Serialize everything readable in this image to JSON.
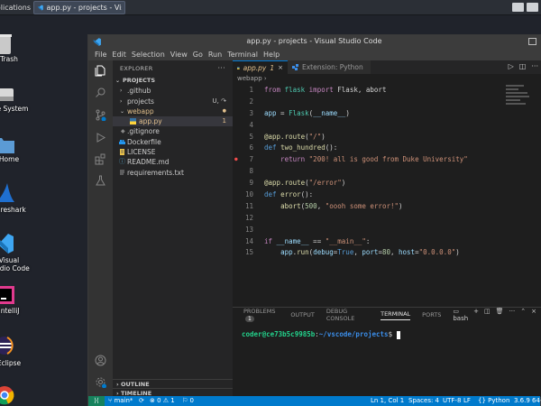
{
  "topbar": {
    "applications_label": "Applications",
    "task_title": "app.py - projects - Visu..."
  },
  "desktop": {
    "icons": [
      {
        "name": "trash",
        "label": "Trash"
      },
      {
        "name": "file-system",
        "label": "File System"
      },
      {
        "name": "home",
        "label": "Home"
      },
      {
        "name": "wireshark",
        "label": "Wireshark"
      },
      {
        "name": "vscode",
        "label": "Visual Studio Code"
      },
      {
        "name": "intellij",
        "label": "IntelliJ"
      },
      {
        "name": "eclipse",
        "label": "Eclipse"
      },
      {
        "name": "chrome",
        "label": ""
      }
    ]
  },
  "window": {
    "title": "app.py - projects - Visual Studio Code"
  },
  "menu": [
    "File",
    "Edit",
    "Selection",
    "View",
    "Go",
    "Run",
    "Terminal",
    "Help"
  ],
  "explorer": {
    "header": "EXPLORER",
    "more": "···",
    "root": "PROJECTS",
    "items": [
      {
        "chev": "›",
        "name": ".github",
        "badge": "",
        "type": "folder"
      },
      {
        "chev": "›",
        "name": "projects",
        "badge": "U, ↷",
        "type": "folder"
      },
      {
        "chev": "⌄",
        "name": "webapp",
        "badge": "●",
        "type": "folder"
      },
      {
        "chev": "",
        "name": "app.py",
        "badge": "1",
        "type": "py"
      },
      {
        "chev": "",
        "name": ".gitignore",
        "badge": "",
        "type": "file"
      },
      {
        "chev": "",
        "name": "Dockerfile",
        "badge": "",
        "type": "docker"
      },
      {
        "chev": "",
        "name": "LICENSE",
        "badge": "",
        "type": "license"
      },
      {
        "chev": "",
        "name": "README.md",
        "badge": "",
        "type": "md"
      },
      {
        "chev": "",
        "name": "requirements.txt",
        "badge": "",
        "type": "txt"
      }
    ],
    "outline": "OUTLINE",
    "timeline": "TIMELINE"
  },
  "tabs": [
    {
      "label": "app.py",
      "suffix": "1",
      "close": "×",
      "active": true
    },
    {
      "label": "Extension: Python",
      "active": false
    }
  ],
  "breadcrumb": "webapp",
  "code": [
    {
      "n": "1",
      "parts": [
        [
          "kw",
          "from "
        ],
        [
          "mod",
          "flask"
        ],
        [
          "kw",
          " import "
        ],
        [
          "",
          "Flask, abort"
        ]
      ]
    },
    {
      "n": "2",
      "parts": []
    },
    {
      "n": "3",
      "parts": [
        [
          "var",
          "app"
        ],
        [
          "",
          " = "
        ],
        [
          "mod",
          "Flask"
        ],
        [
          "",
          "("
        ],
        [
          "var",
          "__name__"
        ],
        [
          "",
          ")"
        ]
      ]
    },
    {
      "n": "4",
      "parts": []
    },
    {
      "n": "5",
      "parts": [
        [
          "fn",
          "@app.route"
        ],
        [
          "",
          "("
        ],
        [
          "str",
          "\"/\""
        ],
        [
          "",
          ")"
        ]
      ]
    },
    {
      "n": "6",
      "parts": [
        [
          "kb",
          "def "
        ],
        [
          "fn",
          "two_hundred"
        ],
        [
          "",
          "():"
        ]
      ]
    },
    {
      "n": "7",
      "parts": [
        [
          "kw",
          "    return "
        ],
        [
          "str",
          "\"200! all is good from Duke University\""
        ]
      ],
      "bp": true
    },
    {
      "n": "8",
      "parts": []
    },
    {
      "n": "9",
      "parts": [
        [
          "fn",
          "@app.route"
        ],
        [
          "",
          "("
        ],
        [
          "str",
          "\"/error\""
        ],
        [
          "",
          ")"
        ]
      ]
    },
    {
      "n": "10",
      "parts": [
        [
          "kb",
          "def "
        ],
        [
          "fn",
          "error"
        ],
        [
          "",
          "():"
        ]
      ]
    },
    {
      "n": "11",
      "parts": [
        [
          "",
          "    "
        ],
        [
          "fn",
          "abort"
        ],
        [
          "",
          "("
        ],
        [
          "num",
          "500"
        ],
        [
          "",
          ", "
        ],
        [
          "str",
          "\"oooh some error!\""
        ],
        [
          "",
          ")"
        ]
      ]
    },
    {
      "n": "12",
      "parts": []
    },
    {
      "n": "13",
      "parts": []
    },
    {
      "n": "14",
      "parts": [
        [
          "kw",
          "if "
        ],
        [
          "var",
          "__name__"
        ],
        [
          "",
          " == "
        ],
        [
          "str",
          "\"__main__\""
        ],
        [
          "",
          ":"
        ]
      ]
    },
    {
      "n": "15",
      "parts": [
        [
          "",
          "    "
        ],
        [
          "var",
          "app"
        ],
        [
          "",
          "."
        ],
        [
          "fn",
          "run"
        ],
        [
          "",
          "("
        ],
        [
          "var",
          "debug"
        ],
        [
          "",
          "="
        ],
        [
          "kb",
          "True"
        ],
        [
          "",
          ", "
        ],
        [
          "var",
          "port"
        ],
        [
          "",
          "="
        ],
        [
          "num",
          "80"
        ],
        [
          "",
          ", "
        ],
        [
          "var",
          "host"
        ],
        [
          "",
          "="
        ],
        [
          "str",
          "\"0.0.0.0\""
        ],
        [
          "",
          ")"
        ]
      ]
    }
  ],
  "panel": {
    "tabs": [
      {
        "label": "PROBLEMS",
        "count": "1"
      },
      {
        "label": "OUTPUT"
      },
      {
        "label": "DEBUG CONSOLE"
      },
      {
        "label": "TERMINAL",
        "active": true
      },
      {
        "label": "PORTS"
      }
    ],
    "shell": "bash",
    "terminal": {
      "user": "coder@ce73b5c9985b",
      "sep": ":",
      "path": "~/vscode/projects",
      "prompt": "$ "
    }
  },
  "status": {
    "branch": "main*",
    "sync": "⟳",
    "errors": "⊗ 0 ⚠ 1",
    "ports": "⚐ 0",
    "position": "Ln 1, Col 1",
    "spaces": "Spaces: 4",
    "encoding": "UTF-8",
    "eol": "LF",
    "language": "{} Python",
    "version": "3.6.9 64-bit"
  },
  "colors": {
    "accent": "#007acc",
    "activity": "#333333",
    "sidebar": "#252526",
    "editor": "#1e1e1e"
  }
}
